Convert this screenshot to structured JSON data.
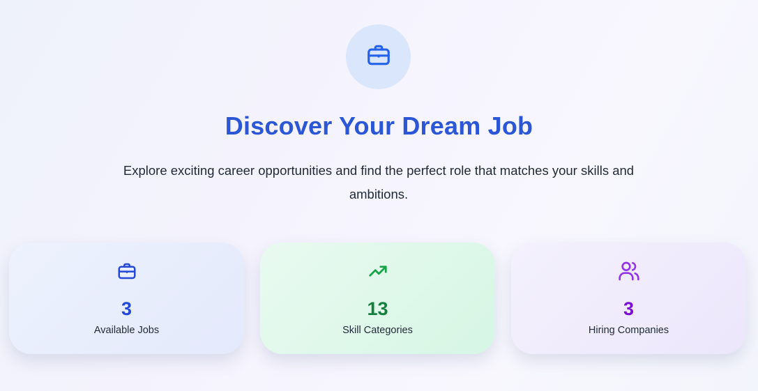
{
  "hero": {
    "icon": "briefcase-icon",
    "title": "Discover Your Dream Job",
    "subtitle": "Explore exciting career opportunities and find the perfect role that matches your skills and ambitions."
  },
  "stats": [
    {
      "icon": "briefcase-icon",
      "value": "3",
      "label": "Available Jobs",
      "color": "#2348d8"
    },
    {
      "icon": "trending-up-icon",
      "value": "13",
      "label": "Skill Categories",
      "color": "#15803d"
    },
    {
      "icon": "users-icon",
      "value": "3",
      "label": "Hiring Companies",
      "color": "#7a0fd0"
    }
  ],
  "colors": {
    "title": "#2b56d6",
    "hero_icon": "#2563eb",
    "hero_badge_bg": "#d9e6fb"
  }
}
